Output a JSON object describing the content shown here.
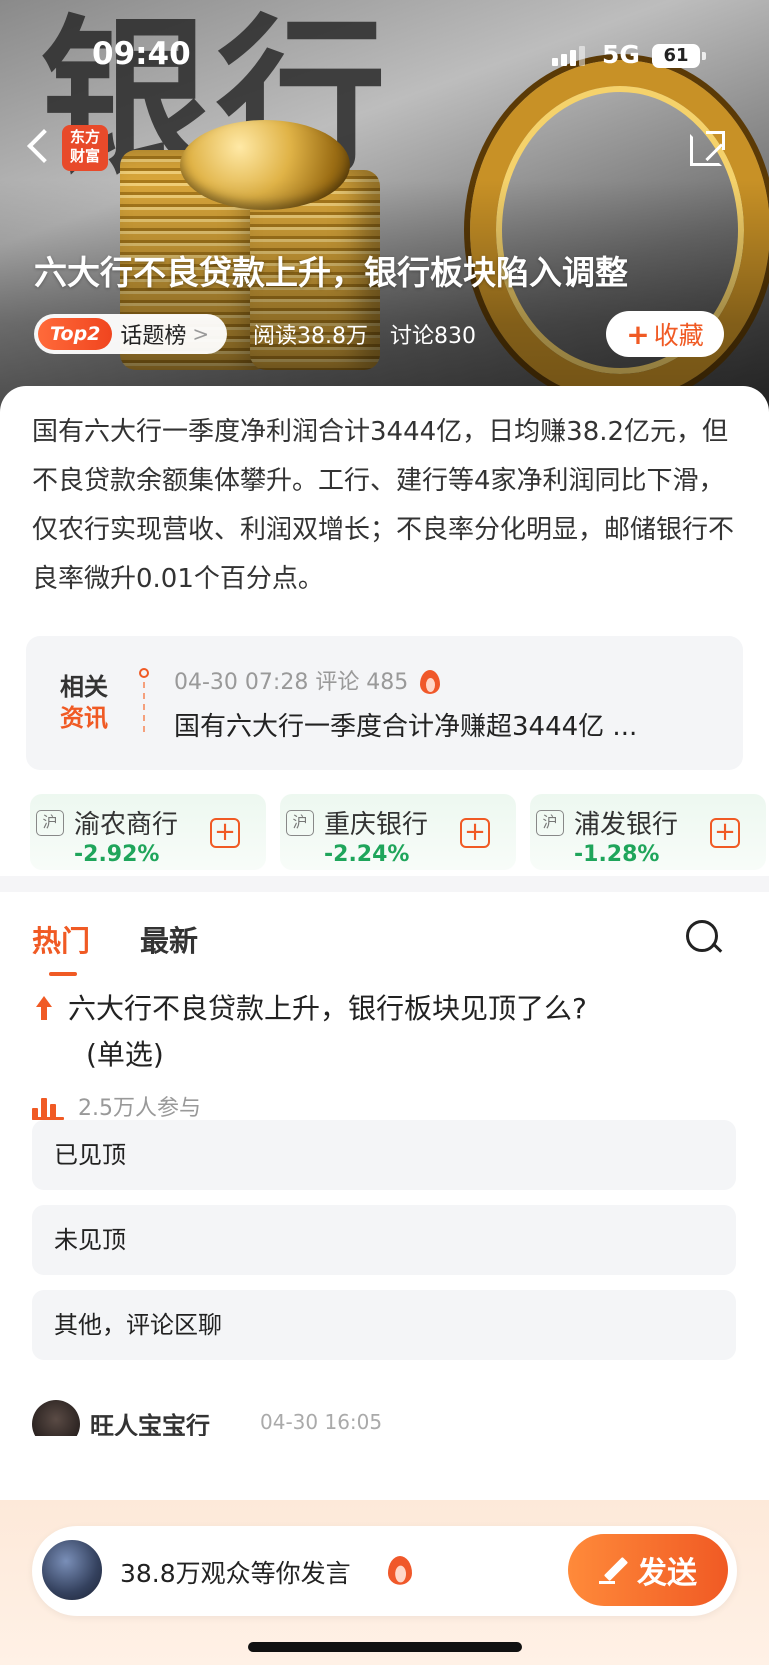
{
  "status": {
    "time": "09:40",
    "network": "5G",
    "battery": "61"
  },
  "header": {
    "logo_text": "东方\n财富",
    "hero_char": "银行"
  },
  "topic": {
    "title": "六大行不良贷款上升，银行板块陷入调整",
    "rank": "Top2",
    "rank_label": "话题榜",
    "reads": "阅读38.8万",
    "discussions": "讨论830",
    "favorite_label": "收藏"
  },
  "summary": "国有六大行一季度净利润合计3444亿，日均赚38.2亿元，但不良贷款余额集体攀升。工行、建行等4家净利润同比下滑，仅农行实现营收、利润双增长；不良率分化明显，邮储银行不良率微升0.01个百分点。",
  "related": {
    "tag_line1": "相关",
    "tag_line2": "资讯",
    "meta": "04-30 07:28 评论 485",
    "headline": "国有六大行一季度合计净赚超3444亿 ..."
  },
  "stocks": [
    {
      "market": "沪",
      "name": "渝农商行",
      "change": "-2.92%"
    },
    {
      "market": "沪",
      "name": "重庆银行",
      "change": "-2.24%"
    },
    {
      "market": "沪",
      "name": "浦发银行",
      "change": "-1.28%"
    }
  ],
  "tabs": [
    {
      "label": "热门"
    },
    {
      "label": "最新"
    }
  ],
  "poll": {
    "question_line1": "六大行不良贷款上升，银行板块见顶了么?",
    "question_line2": "(单选)",
    "participants": "2.5万人参与",
    "options": [
      "已见顶",
      "未见顶",
      "其他，评论区聊"
    ]
  },
  "comment_peek": {
    "name": "旺人宝宝行",
    "time": "04-30 16:05"
  },
  "composer": {
    "placeholder": "38.8万观众等你发言",
    "send_label": "发送"
  },
  "colors": {
    "accent": "#f05a24",
    "down": "#1fa55b"
  }
}
